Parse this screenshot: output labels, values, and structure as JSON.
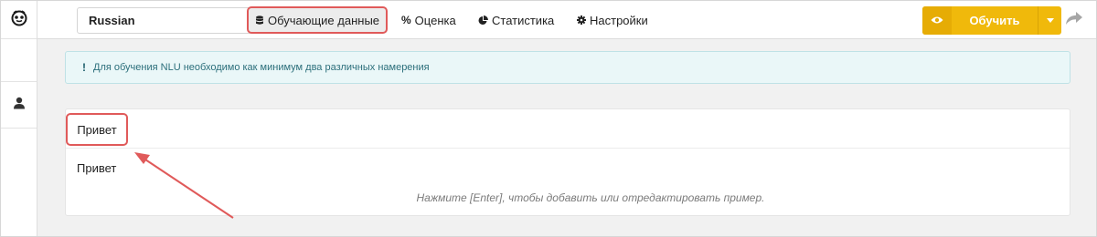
{
  "app": {
    "brand_icon": "owl-logo-icon",
    "user_icon": "user-icon"
  },
  "toolbar": {
    "language": "Russian",
    "nav": [
      {
        "label": "Обучающие данные",
        "icon": "database-icon",
        "active": true
      },
      {
        "label": "Оценка",
        "icon": "percent-icon",
        "active": false
      },
      {
        "label": "Статистика",
        "icon": "pie-chart-icon",
        "active": false
      },
      {
        "label": "Настройки",
        "icon": "gear-icon",
        "active": false
      }
    ],
    "train_label": "Обучить",
    "train_color": "#f0b90b",
    "share_icon": "share-arrow-icon"
  },
  "alert": {
    "text": "Для обучения NLU необходимо как минимум два различных намерения"
  },
  "intent": {
    "name": "Привет",
    "examples": [
      "Привет"
    ],
    "hint": "Нажмите [Enter], чтобы добавить или отредактировать пример."
  },
  "colors": {
    "highlight": "#e05a5a",
    "accent": "#f0b90b"
  }
}
